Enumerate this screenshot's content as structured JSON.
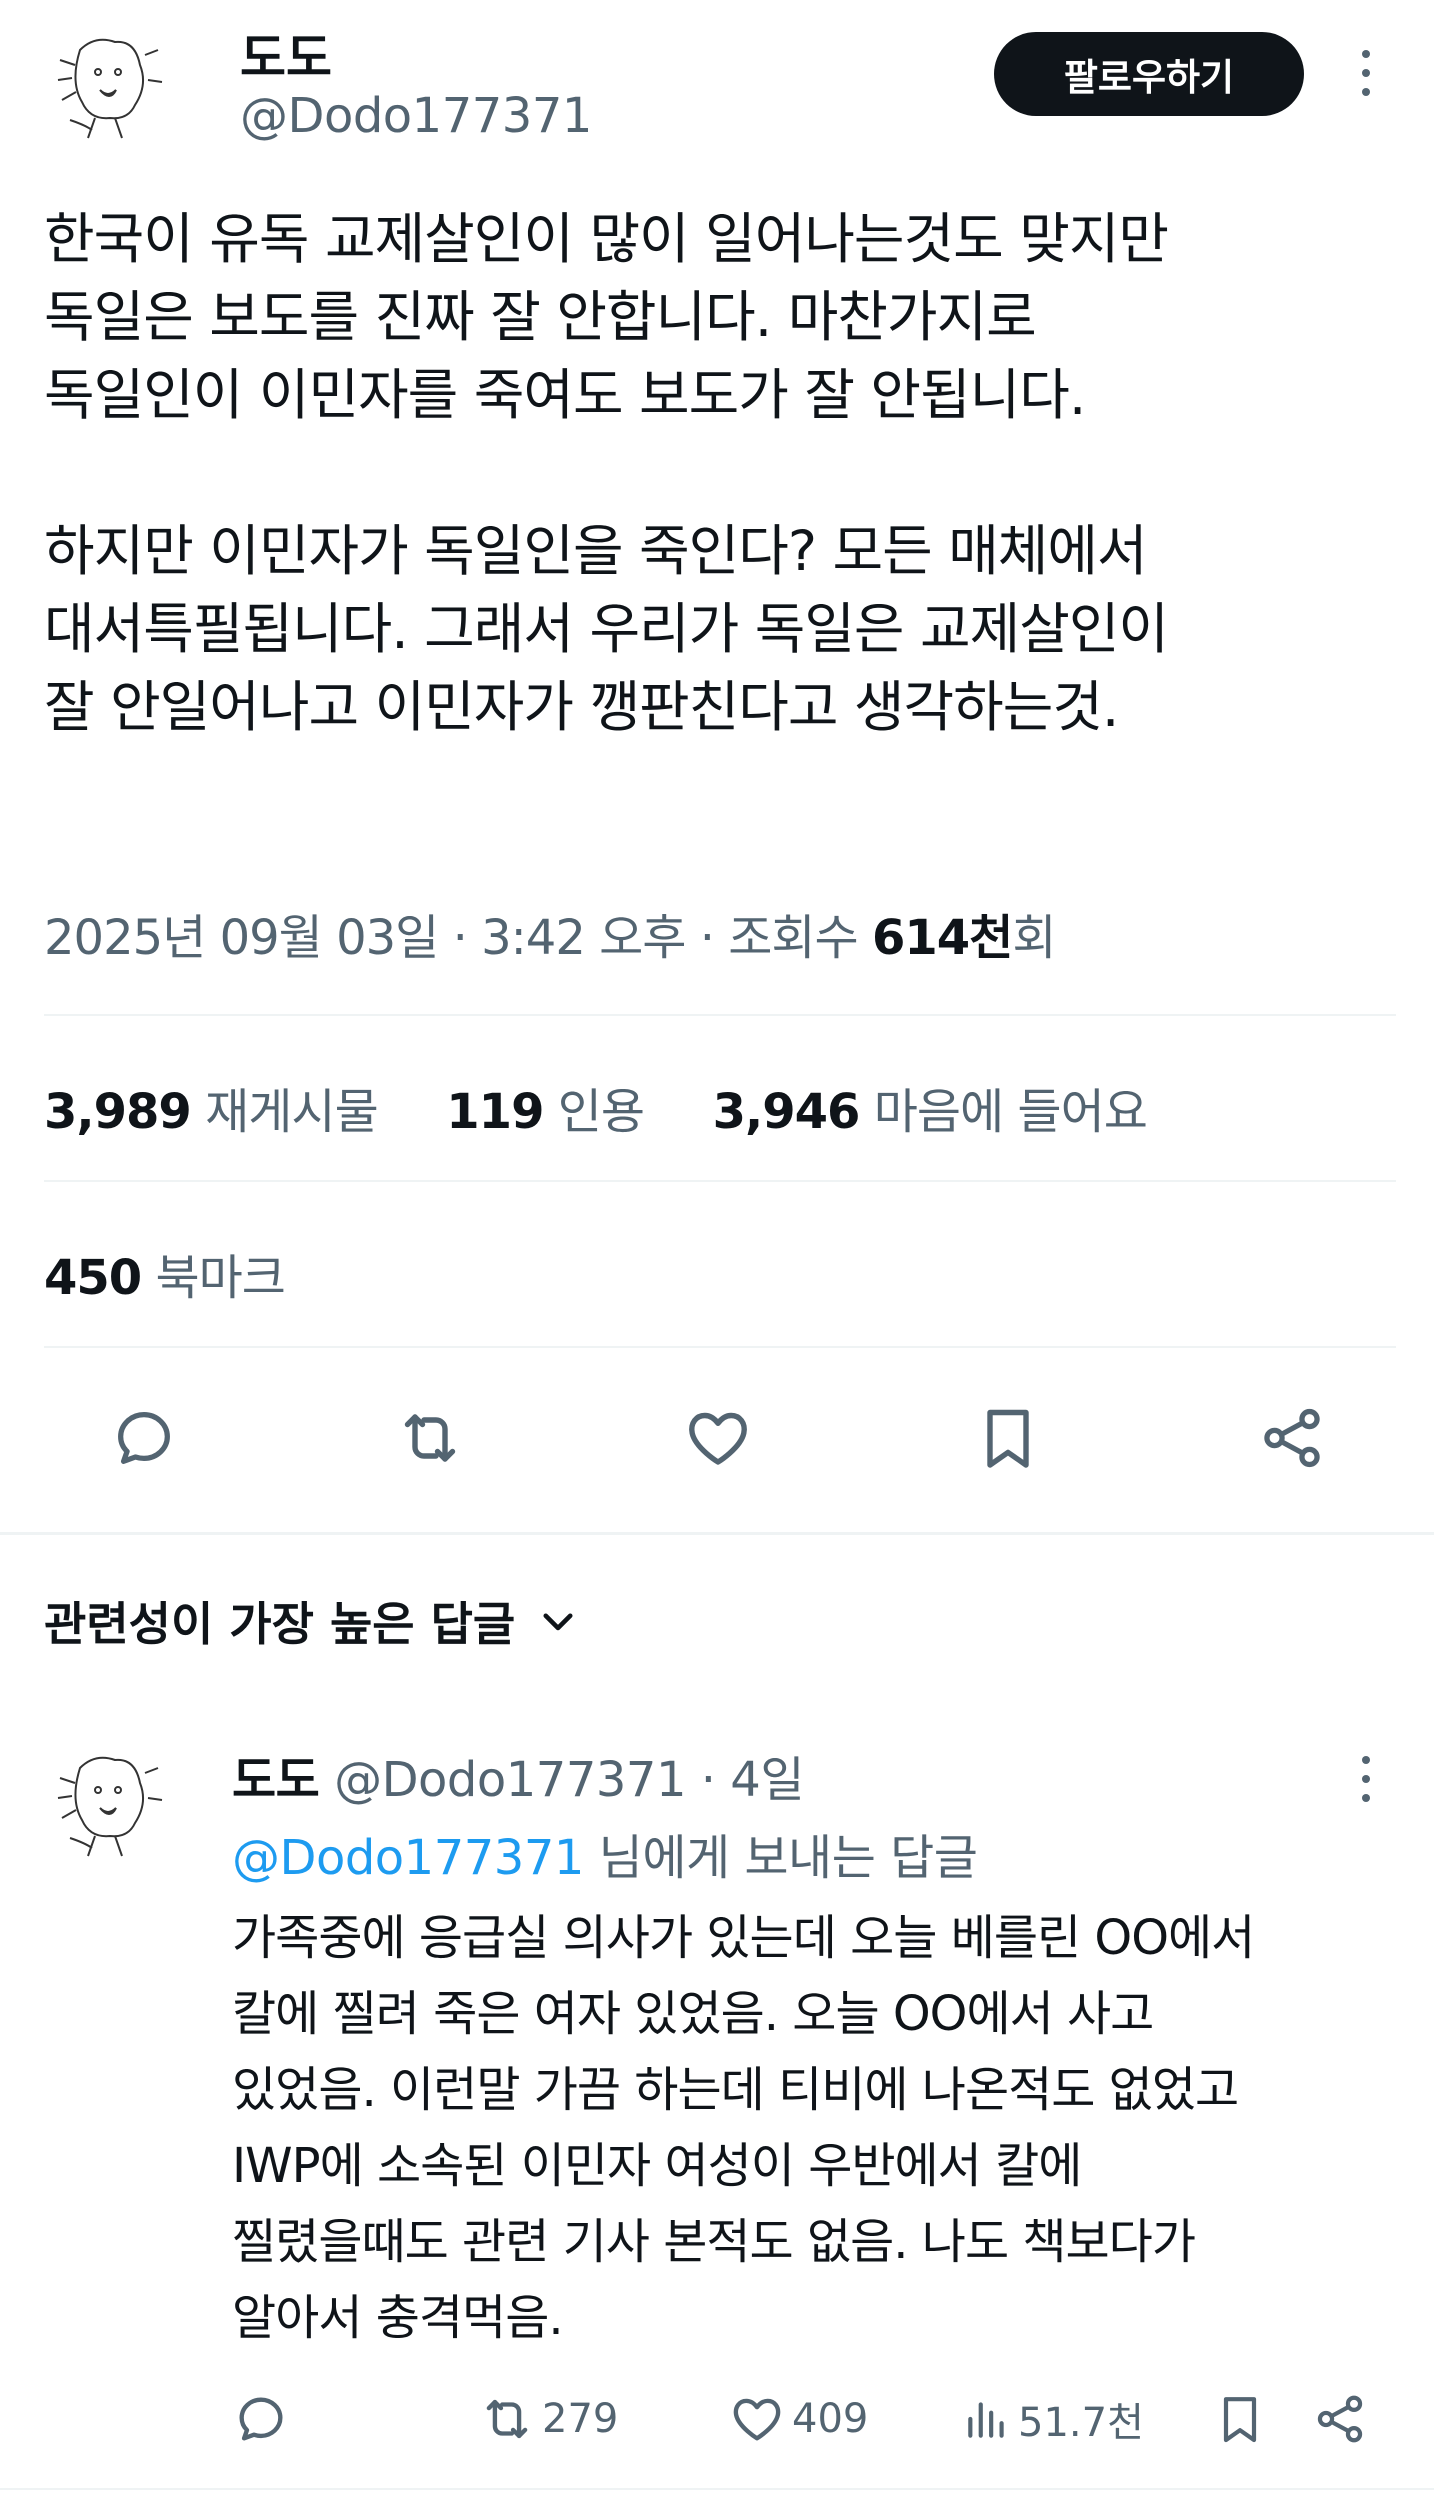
{
  "tweet": {
    "author_name": "도도",
    "author_handle": "@Dodo177371",
    "follow_label": "팔로우하기",
    "text": "한국이 유독 교제살인이 많이 일어나는것도 맞지만\n독일은 보도를 진짜 잘 안합니다. 마찬가지로\n독일인이 이민자를 죽여도 보도가 잘 안됩니다.\n\n하지만 이민자가 독일인을 죽인다? 모든 매체에서\n대서특필됩니다. 그래서 우리가 독일은 교제살인이\n잘 안일어나고 이민자가 깽판친다고 생각하는것.",
    "meta_prefix": "2025년 09월 03일 · 3:42 오후 · 조회수 ",
    "views": "614천",
    "views_suffix": "회"
  },
  "stats": {
    "reposts_count": "3,989",
    "reposts_label": "재게시물",
    "quotes_count": "119",
    "quotes_label": "인용",
    "likes_count": "3,946",
    "likes_label": "마음에 들어요",
    "bookmarks_count": "450",
    "bookmarks_label": "북마크"
  },
  "actions": [
    "reply-icon",
    "repost-icon",
    "like-icon",
    "bookmark-icon",
    "share-icon"
  ],
  "replies_sort": {
    "label": "관련성이 가장 높은 답글"
  },
  "reply": {
    "author_name": "도도",
    "author_handle": "@Dodo177371",
    "time": "· 4일",
    "replying_to_mention": "@Dodo177371",
    "replying_to_suffix": " 님에게 보내는 답글",
    "text": "가족중에 응급실 의사가 있는데 오늘 베를린 OO에서\n칼에 찔려 죽은 여자 있었음. 오늘 OO에서 사고\n있었음. 이런말 가끔 하는데 티비에 나온적도 없었고\nIWP에 소속된 이민자 여성이 우반에서 칼에\n찔렸을때도 관련 기사 본적도 없음. 나도 책보다가\n알아서 충격먹음.",
    "reposts": "279",
    "likes": "409",
    "views": "51.7천"
  },
  "colors": {
    "text": "#0f1419",
    "muted": "#536471",
    "link": "#1d9bf0",
    "divider": "#eff3f4",
    "button_bg": "#0f1419"
  }
}
